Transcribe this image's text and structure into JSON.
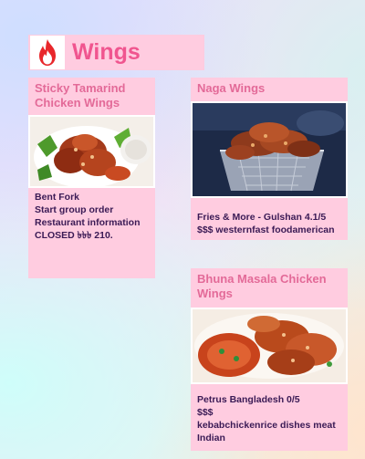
{
  "header": {
    "title": "Wings",
    "logo_icon": "fire-icon"
  },
  "cards": [
    {
      "title": "Sticky Tamarind Chicken Wings",
      "image_icon": "food-photo",
      "info": {
        "restaurant": "Bent Fork",
        "link1": "Start group order",
        "link2": "Restaurant information",
        "status": "CLOSED ৳৳৳ 210."
      }
    },
    {
      "title": "Naga Wings",
      "image_icon": "food-photo",
      "info": {
        "line1": "Fries & More - Gulshan 4.1/5",
        "line2": "$$$ westernfast foodamerican"
      }
    },
    {
      "title": "Bhuna Masala Chicken Wings",
      "image_icon": "food-photo",
      "info": {
        "line1": "Petrus Bangladesh 0/5",
        "line2": "$$$",
        "line3": "kebabchickenrice dishes meat Indian"
      }
    }
  ],
  "colors": {
    "card_bg": "#ffcce0",
    "title_text": "#f0558f",
    "card_title": "#e36a98",
    "info_text": "#3a1a55"
  }
}
